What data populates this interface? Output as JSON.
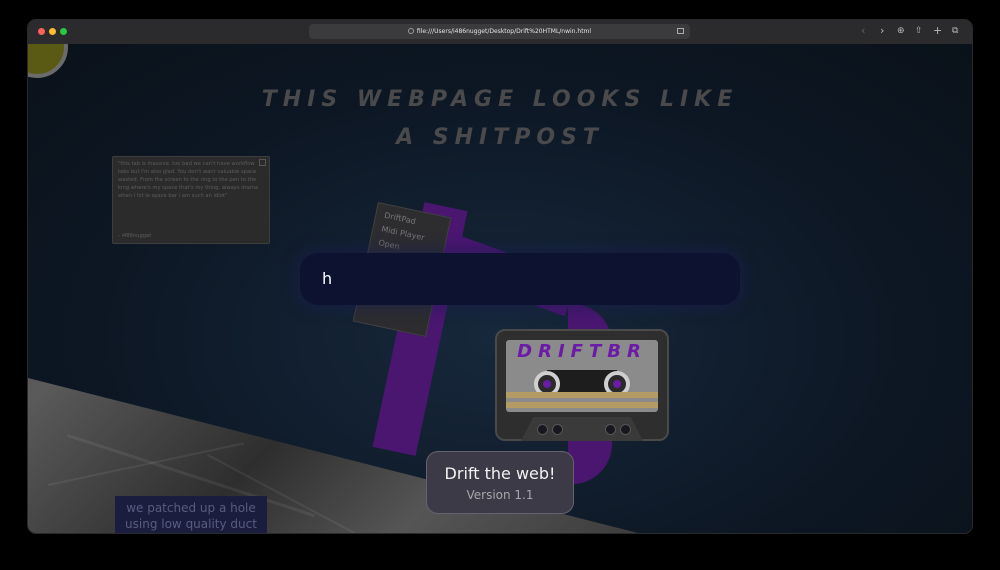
{
  "browser": {
    "url": "file:///Users/i486nugget/Desktop/Drift%20HTML/nwin.html",
    "icons": [
      "close-light",
      "minimize-light",
      "maximize-light",
      "back-icon",
      "forward-icon",
      "download-icon",
      "share-icon",
      "new-tab-icon",
      "tabs-overview-icon"
    ]
  },
  "page": {
    "headline_line1": "THIS WEBPAGE LOOKS LIKE",
    "headline_line2": "A SHITPOST",
    "quote": {
      "text": "\"this tab is massive. too bad we can't have workflow tabs but I'm also glad. You don't want valuable space wasted. From the screen to the ring to the pen to the king where's my space that's my thing. always drama when I hit le space bar i am such an idiot\"",
      "author": "- i486nugget"
    },
    "dropdown_items": [
      "DriftPad",
      "Midi Player",
      "Open"
    ],
    "search_value": "h",
    "patch_text": "we patched up a hole using low quality duct tape",
    "cassette_brand": "DRIFTBR",
    "cta_title": "Drift the web!",
    "cta_version": "Version 1.1"
  },
  "colors": {
    "background": "#0d1724",
    "accent_purple": "#5a1a8a",
    "search_bar": "#0c1230",
    "cta_box": "#3c3a46"
  }
}
